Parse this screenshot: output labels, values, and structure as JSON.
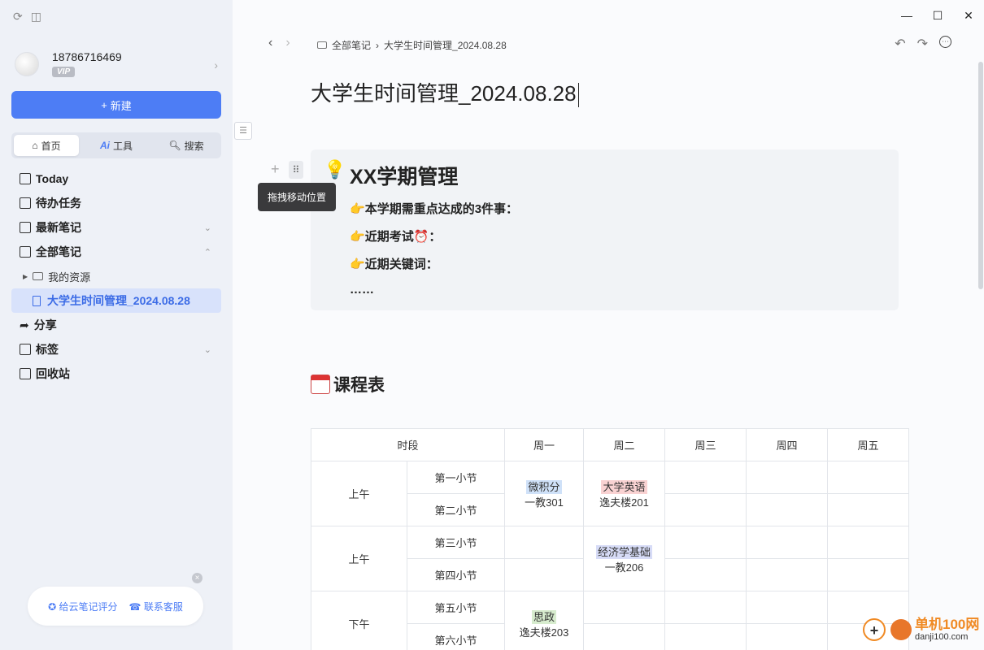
{
  "sidebar": {
    "username": "18786716469",
    "vip_badge": "VIP",
    "new_button": "新建",
    "tabs": [
      {
        "label": "首页"
      },
      {
        "label": "工具",
        "prefix": "Ai"
      },
      {
        "label": "搜索"
      }
    ],
    "nav": {
      "today": "Today",
      "todo": "待办任务",
      "recent": "最新笔记",
      "all": "全部笔记",
      "my_resources": "我的资源",
      "current_note": "大学生时间管理_2024.08.28",
      "share": "分享",
      "tags": "标签",
      "trash": "回收站"
    },
    "footer": {
      "rate": "给云笔记评分",
      "contact": "联系客服"
    }
  },
  "main": {
    "breadcrumb": {
      "root": "全部笔记",
      "current": "大学生时间管理_2024.08.28"
    },
    "title": "大学生时间管理_2024.08.28",
    "tooltip": "拖拽移动位置",
    "callout": {
      "heading": "XX学期管理",
      "lines": [
        "本学期需重点达成的3件事：",
        "近期考试⏰：",
        "近期关键词：",
        "……"
      ]
    },
    "section_title": "课程表",
    "table": {
      "headers": [
        "时段",
        "周一",
        "周二",
        "周三",
        "周四",
        "周五"
      ],
      "groups": [
        "上午",
        "上午",
        "下午"
      ],
      "slots": [
        "第一小节",
        "第二小节",
        "第三小节",
        "第四小节",
        "第五小节",
        "第六小节"
      ],
      "cells": {
        "calculus": {
          "course": "微积分",
          "room": "一教301"
        },
        "english": {
          "course": "大学英语",
          "room": "逸夫楼201"
        },
        "economics": {
          "course": "经济学基础",
          "room": "一教206"
        },
        "politics": {
          "course": "思政",
          "room": "逸夫楼203"
        }
      }
    }
  },
  "watermark": {
    "name": "单机100网",
    "site": "danji100.com"
  }
}
